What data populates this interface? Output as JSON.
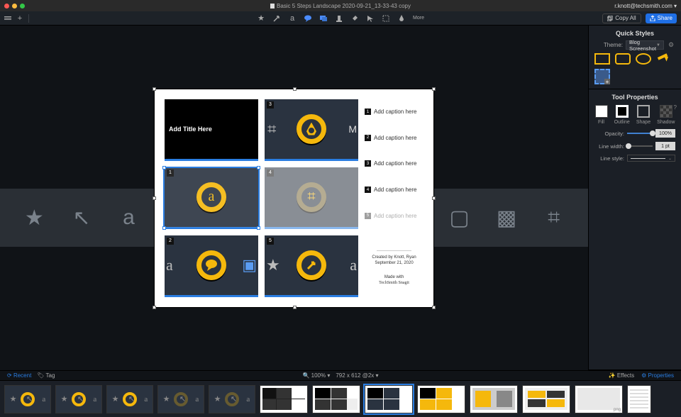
{
  "titlebar": {
    "docname": "Basic 5 Steps Landscape 2020-09-21_13-33-43 copy",
    "account": "r.knott@techsmith.com ▾"
  },
  "toolbar": {
    "more": "More",
    "copyall": "Copy All",
    "share": "Share"
  },
  "panel": {
    "quick": "Quick Styles",
    "theme_label": "Theme:",
    "theme_value": "Blog Screenshot",
    "tool": "Tool Properties",
    "fill": "Fill",
    "outline": "Outline",
    "shape": "Shape",
    "shadow": "Shadow",
    "opacity": "Opacity:",
    "opacity_val": "100%",
    "linewidth": "Line width:",
    "linewidth_val": "1 pt",
    "linestyle": "Line style:"
  },
  "doc": {
    "title": "Add Title Here",
    "cap1": "Add caption here",
    "cap2": "Add caption here",
    "cap3": "Add caption here",
    "cap4": "Add caption here",
    "cap5": "Add caption here",
    "n1": "1",
    "n2": "2",
    "n3": "3",
    "n4": "4",
    "n5": "5",
    "credit1": "Created by Knott, Ryan",
    "credit2": "September 21, 2020",
    "madewith": "Made with",
    "brand": "TechSmith Snagit"
  },
  "bbar": {
    "recent": "Recent",
    "tag": "Tag",
    "zoom": "100%",
    "dims": "792 x 612 @2x",
    "effects": "Effects",
    "props": "Properties"
  },
  "tray": {
    "fmt": "png"
  }
}
